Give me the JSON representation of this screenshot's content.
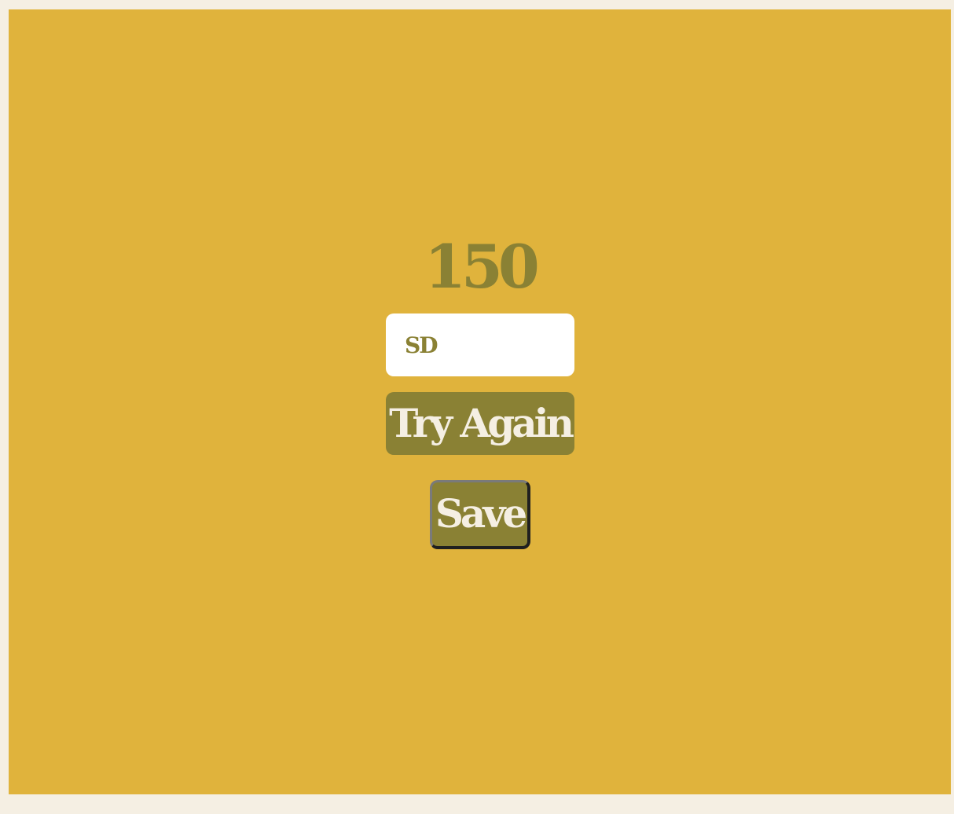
{
  "game": {
    "score": "150",
    "name_input_value": "SD",
    "try_again_label": "Try Again",
    "save_label": "Save"
  },
  "colors": {
    "page_background": "#f5efe3",
    "panel_background": "#e0b33c",
    "accent": "#8a8134",
    "input_background": "#ffffff",
    "button_text": "#f5efe3"
  }
}
